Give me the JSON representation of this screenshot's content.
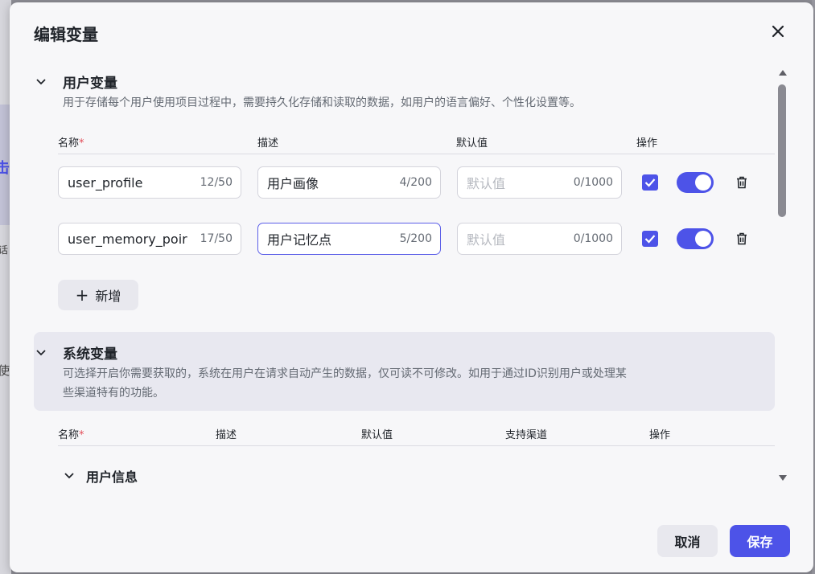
{
  "modal": {
    "title": "编辑变量",
    "cancel_label": "取消",
    "save_label": "保存"
  },
  "background": {
    "fragments": [
      "击",
      "话",
      "使"
    ]
  },
  "user_vars": {
    "title": "用户变量",
    "description": "用于存储每个用户使用项目过程中，需要持久化存储和读取的数据，如用户的语言偏好、个性化设置等。",
    "columns": {
      "name": "名称",
      "required_mark": "*",
      "desc": "描述",
      "default": "默认值",
      "actions": "操作"
    },
    "rows": [
      {
        "name": "user_profile",
        "name_count": "12/50",
        "desc": "用户画像",
        "desc_count": "4/200",
        "default_placeholder": "默认值",
        "default_count": "0/1000",
        "enabled": true
      },
      {
        "name": "user_memory_poir",
        "name_count": "17/50",
        "desc": "用户记忆点",
        "desc_count": "5/200",
        "default_placeholder": "默认值",
        "default_count": "0/1000",
        "enabled": true
      }
    ],
    "add_label": "新增"
  },
  "system_vars": {
    "title": "系统变量",
    "description_line1": "可选择开启你需要获取的，系统在用户在请求自动产生的数据，仅可读不可修改。如用于通过ID识别用户或处理某",
    "description_line2": "些渠道特有的功能。",
    "columns": {
      "name": "名称",
      "required_mark": "*",
      "desc": "描述",
      "default": "默认值",
      "channel": "支持渠道",
      "actions": "操作"
    },
    "group_title": "用户信息"
  },
  "colors": {
    "accent": "#4d53e8",
    "required": "#e34d59"
  },
  "icons": [
    "close-icon",
    "chevron-down-icon",
    "check-icon",
    "trash-icon",
    "plus-icon",
    "scroll-up-icon",
    "scroll-down-icon"
  ]
}
